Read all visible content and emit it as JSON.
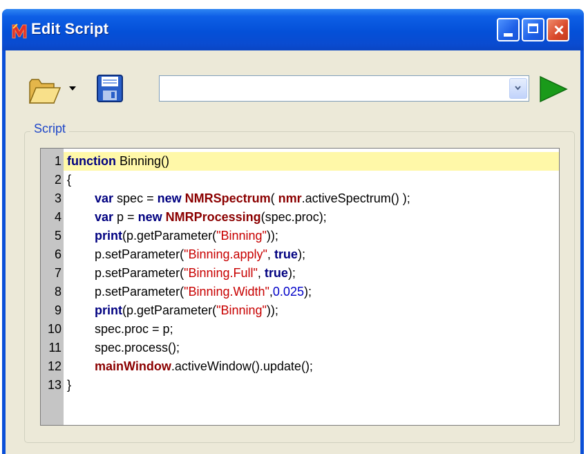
{
  "window": {
    "title": "Edit Script",
    "controls": {
      "minimize": "minimize",
      "maximize": "maximize",
      "close": "×"
    }
  },
  "toolbar": {
    "script_select_value": "",
    "icons": [
      "open-folder-icon",
      "dropdown-arrow-icon",
      "save-floppy-icon",
      "chevron-down-icon",
      "run-play-icon"
    ]
  },
  "script_group": {
    "label": "Script"
  },
  "editor": {
    "lines": [
      {
        "num": "1",
        "tokens": [
          [
            "kw",
            "function"
          ],
          [
            "plain",
            " Binning()"
          ]
        ]
      },
      {
        "num": "2",
        "tokens": [
          [
            "plain",
            "{"
          ]
        ]
      },
      {
        "num": "3",
        "tokens": [
          [
            "plain",
            "        "
          ],
          [
            "kw",
            "var"
          ],
          [
            "plain",
            " spec = "
          ],
          [
            "kw",
            "new"
          ],
          [
            "plain",
            " "
          ],
          [
            "ty",
            "NMRSpectrum"
          ],
          [
            "plain",
            "( "
          ],
          [
            "ty",
            "nmr"
          ],
          [
            "plain",
            ".activeSpectrum() );"
          ]
        ]
      },
      {
        "num": "4",
        "tokens": [
          [
            "plain",
            "        "
          ],
          [
            "kw",
            "var"
          ],
          [
            "plain",
            " p = "
          ],
          [
            "kw",
            "new"
          ],
          [
            "plain",
            " "
          ],
          [
            "ty",
            "NMRProcessing"
          ],
          [
            "plain",
            "(spec.proc);"
          ]
        ]
      },
      {
        "num": "5",
        "tokens": [
          [
            "plain",
            "        "
          ],
          [
            "kw",
            "print"
          ],
          [
            "plain",
            "(p.getParameter("
          ],
          [
            "str",
            "\"Binning\""
          ],
          [
            "plain",
            "));"
          ]
        ]
      },
      {
        "num": "6",
        "tokens": [
          [
            "plain",
            "        p.setParameter("
          ],
          [
            "str",
            "\"Binning.apply\""
          ],
          [
            "plain",
            ", "
          ],
          [
            "kw",
            "true"
          ],
          [
            "plain",
            ");"
          ]
        ]
      },
      {
        "num": "7",
        "tokens": [
          [
            "plain",
            "        p.setParameter("
          ],
          [
            "str",
            "\"Binning.Full\""
          ],
          [
            "plain",
            ", "
          ],
          [
            "kw",
            "true"
          ],
          [
            "plain",
            ");"
          ]
        ]
      },
      {
        "num": "8",
        "tokens": [
          [
            "plain",
            "        p.setParameter("
          ],
          [
            "str",
            "\"Binning.Width\""
          ],
          [
            "plain",
            ","
          ],
          [
            "num",
            "0.025"
          ],
          [
            "plain",
            ");"
          ]
        ]
      },
      {
        "num": "9",
        "tokens": [
          [
            "plain",
            "        "
          ],
          [
            "kw",
            "print"
          ],
          [
            "plain",
            "(p.getParameter("
          ],
          [
            "str",
            "\"Binning\""
          ],
          [
            "plain",
            "));"
          ]
        ]
      },
      {
        "num": "10",
        "tokens": [
          [
            "plain",
            "        spec.proc = p;"
          ]
        ]
      },
      {
        "num": "11",
        "tokens": [
          [
            "plain",
            "        spec.process();"
          ]
        ]
      },
      {
        "num": "12",
        "tokens": [
          [
            "plain",
            "        "
          ],
          [
            "ty",
            "mainWindow"
          ],
          [
            "plain",
            ".activeWindow().update();"
          ]
        ]
      },
      {
        "num": "13",
        "tokens": [
          [
            "plain",
            "}"
          ]
        ]
      }
    ],
    "highlight_line": 1,
    "colors": {
      "keyword": "#000080",
      "type": "#8b0000",
      "string": "#c80000",
      "number": "#0000c8",
      "current_line": "#fff8a8",
      "gutter": "#c5c5c5"
    }
  }
}
